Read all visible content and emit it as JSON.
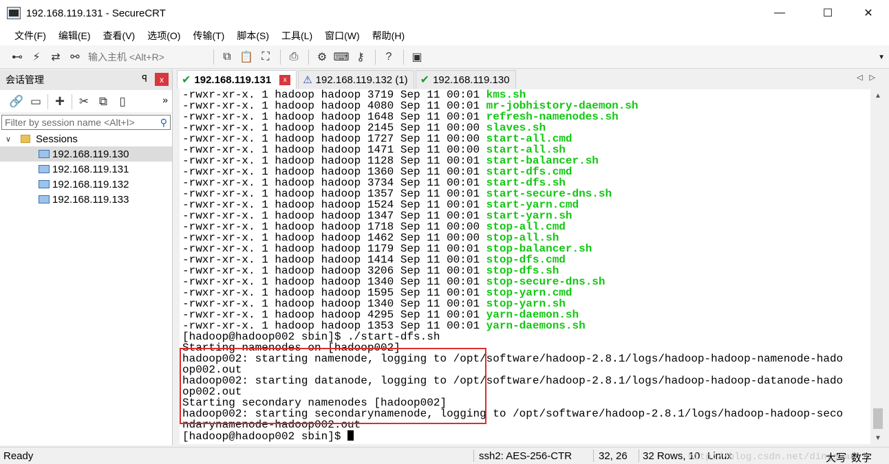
{
  "window": {
    "title": "192.168.119.131 - SecureCRT",
    "controls": {
      "minimize": "—",
      "maximize": "☐",
      "close": "✕"
    }
  },
  "menubar": {
    "items": [
      "文件(F)",
      "编辑(E)",
      "查看(V)",
      "选项(O)",
      "传输(T)",
      "脚本(S)",
      "工具(L)",
      "窗口(W)",
      "帮助(H)"
    ]
  },
  "toolbar": {
    "host_placeholder": "输入主机 <Alt+R>"
  },
  "session_panel": {
    "title": "会话管理",
    "pin": "ꟼ",
    "close": "x",
    "filter_placeholder": "Filter by session name <Alt+I>",
    "root_label": "Sessions",
    "sessions": [
      "192.168.119.130",
      "192.168.119.131",
      "192.168.119.132",
      "192.168.119.133"
    ]
  },
  "tabs": [
    {
      "label": "192.168.119.131",
      "status": "connected",
      "active": true
    },
    {
      "label": "192.168.119.132 (1)",
      "status": "warning",
      "active": false
    },
    {
      "label": "192.168.119.130",
      "status": "connected",
      "active": false
    }
  ],
  "terminal": {
    "listing": [
      {
        "meta": "-rwxr-xr-x. 1 hadoop hadoop 3719 Sep 11 00:01 ",
        "name": "kms.sh"
      },
      {
        "meta": "-rwxr-xr-x. 1 hadoop hadoop 4080 Sep 11 00:01 ",
        "name": "mr-jobhistory-daemon.sh"
      },
      {
        "meta": "-rwxr-xr-x. 1 hadoop hadoop 1648 Sep 11 00:01 ",
        "name": "refresh-namenodes.sh"
      },
      {
        "meta": "-rwxr-xr-x. 1 hadoop hadoop 2145 Sep 11 00:00 ",
        "name": "slaves.sh"
      },
      {
        "meta": "-rwxr-xr-x. 1 hadoop hadoop 1727 Sep 11 00:00 ",
        "name": "start-all.cmd"
      },
      {
        "meta": "-rwxr-xr-x. 1 hadoop hadoop 1471 Sep 11 00:00 ",
        "name": "start-all.sh"
      },
      {
        "meta": "-rwxr-xr-x. 1 hadoop hadoop 1128 Sep 11 00:01 ",
        "name": "start-balancer.sh"
      },
      {
        "meta": "-rwxr-xr-x. 1 hadoop hadoop 1360 Sep 11 00:01 ",
        "name": "start-dfs.cmd"
      },
      {
        "meta": "-rwxr-xr-x. 1 hadoop hadoop 3734 Sep 11 00:01 ",
        "name": "start-dfs.sh"
      },
      {
        "meta": "-rwxr-xr-x. 1 hadoop hadoop 1357 Sep 11 00:01 ",
        "name": "start-secure-dns.sh"
      },
      {
        "meta": "-rwxr-xr-x. 1 hadoop hadoop 1524 Sep 11 00:01 ",
        "name": "start-yarn.cmd"
      },
      {
        "meta": "-rwxr-xr-x. 1 hadoop hadoop 1347 Sep 11 00:01 ",
        "name": "start-yarn.sh"
      },
      {
        "meta": "-rwxr-xr-x. 1 hadoop hadoop 1718 Sep 11 00:00 ",
        "name": "stop-all.cmd"
      },
      {
        "meta": "-rwxr-xr-x. 1 hadoop hadoop 1462 Sep 11 00:00 ",
        "name": "stop-all.sh"
      },
      {
        "meta": "-rwxr-xr-x. 1 hadoop hadoop 1179 Sep 11 00:01 ",
        "name": "stop-balancer.sh"
      },
      {
        "meta": "-rwxr-xr-x. 1 hadoop hadoop 1414 Sep 11 00:01 ",
        "name": "stop-dfs.cmd"
      },
      {
        "meta": "-rwxr-xr-x. 1 hadoop hadoop 3206 Sep 11 00:01 ",
        "name": "stop-dfs.sh"
      },
      {
        "meta": "-rwxr-xr-x. 1 hadoop hadoop 1340 Sep 11 00:01 ",
        "name": "stop-secure-dns.sh"
      },
      {
        "meta": "-rwxr-xr-x. 1 hadoop hadoop 1595 Sep 11 00:01 ",
        "name": "stop-yarn.cmd"
      },
      {
        "meta": "-rwxr-xr-x. 1 hadoop hadoop 1340 Sep 11 00:01 ",
        "name": "stop-yarn.sh"
      },
      {
        "meta": "-rwxr-xr-x. 1 hadoop hadoop 4295 Sep 11 00:01 ",
        "name": "yarn-daemon.sh"
      },
      {
        "meta": "-rwxr-xr-x. 1 hadoop hadoop 1353 Sep 11 00:01 ",
        "name": "yarn-daemons.sh"
      }
    ],
    "output": [
      "[hadoop@hadoop002 sbin]$ ./start-dfs.sh",
      "Starting namenodes on [hadoop002]",
      "hadoop002: starting namenode, logging to /opt/software/hadoop-2.8.1/logs/hadoop-hadoop-namenode-hado",
      "op002.out",
      "hadoop002: starting datanode, logging to /opt/software/hadoop-2.8.1/logs/hadoop-hadoop-datanode-hado",
      "op002.out",
      "Starting secondary namenodes [hadoop002]",
      "hadoop002: starting secondarynamenode, logging to /opt/software/hadoop-2.8.1/logs/hadoop-hadoop-seco",
      "ndarynamenode-hadoop002.out"
    ],
    "prompt": "[hadoop@hadoop002 sbin]$ ",
    "filename_color": "#11c711",
    "highlight_color": "#e12a2a"
  },
  "statusbar": {
    "ready": "Ready",
    "cipher": "ssh2: AES-256-CTR",
    "cursor_pos": "32,  26",
    "rows_cols": "32 Rows, 10",
    "os": "Linux",
    "watermark": "http://blog.csdn.net/dingguanyi",
    "caps": "大写",
    "num": "数字"
  }
}
